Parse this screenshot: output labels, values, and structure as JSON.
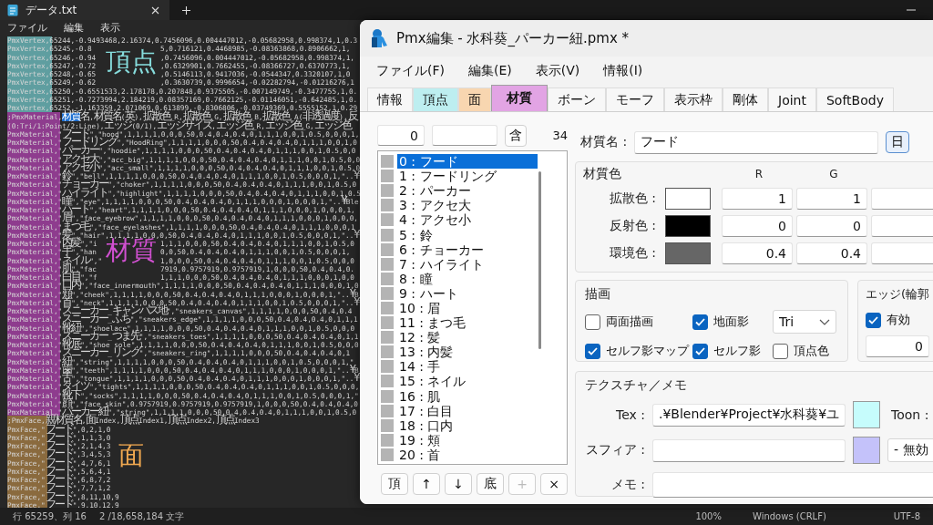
{
  "notepad": {
    "tab_title": "データ.txt",
    "menu": [
      "ファイル",
      "編集",
      "表示"
    ],
    "sections": [
      {
        "kind": "vertex",
        "label": "頂点",
        "color": "#86dcdc",
        "lines": [
          {
            "text": "PmxVertex,65244,-0.9493468,2.16374,0.7456096,0.004447012,-0.05682958,0.998374,1,0.3"
          },
          {
            "text": "PmxVertex,65245,-0.8",
            "after": "5,0.716121,0.4468985,-0.08363868,0.8906662,1,"
          },
          {
            "text": "PmxVertex,65246,-0.94",
            "after": ",0.7456096,0.004447012,-0.05682958,0.998374,1,"
          },
          {
            "text": "PmxVertex,65247,-0.72",
            "after": ",0.6329901,0.7662455,-0.08366727,0.6370773,1,"
          },
          {
            "text": "PmxVertex,65248,-0.65",
            "after": ",0.5146113,0.9417036,-0.0544347,0.3320107,1,0"
          },
          {
            "text": "PmxVertex,65249,-0.62",
            "after": ",0.3630739,0.9996654,-0.02282794,-0.01216276,1"
          },
          {
            "text": "PmxVertex,65250,-0.6551533,2.178178,0.207848,0.9375505,-0.007149749,-0.3477755,1,0."
          },
          {
            "text": "PmxVertex,65251,-0.7273994,2.184219,0.08357169,0.7662125,-0.01146051,-0.642485,1,0."
          },
          {
            "text": "PmxVertex,65252,-1.163359,2.071069,0.613899,-0.8306806,-0.03749369,0.5555152,1,0.29"
          }
        ]
      },
      {
        "kind": "material",
        "label": "材質",
        "color": "#d050d0",
        "lines": [
          {
            "text": ";PmxMaterial,",
            "selection": "材質",
            "tail": "名,材質名(英),拡散色_R,拡散色_G,拡散色_B,拡散色_A(非透過度),反"
          },
          {
            "text": "(0:Tri/1:Point/2:Line),エッジ(0/1),エッジサイズ,エッジ色_R,エッジ色_G,エッジ色"
          },
          {
            "text": "PmxMaterial,\"フード\",\"hood\",1,1,1,1,0,0,0,50,0.4,0.4,0.4,0,1,1,1,0,0,1,0.5,0,0,0,1,"
          },
          {
            "text": "PmxMaterial,\"フードリング\",\"HoodRing\",1,1,1,1,0,0,0,50,0.4,0.4,0.4,0,1,1,1,0,0,1,0"
          },
          {
            "text": "PmxMaterial,\"パーカー\",\"hoodie\",1,1,1,1,0,0,0,50,0.4,0.4,0.4,0,1,1,1,0,0,1,0.5,0,0"
          },
          {
            "text": "PmxMaterial,\"アクセ大\",\"acc_big\",1,1,1,1,0,0,0,50,0.4,0.4,0.4,0,1,1,1,0,0,1,0.5,0,0"
          },
          {
            "text": "PmxMaterial,\"アクセ小\",\"acc_small\",1,1,1,1,0,0,0,50,0.4,0.4,0.4,0,1,1,1,0,0,1,0.5,0"
          },
          {
            "text": "PmxMaterial,\"鈴\",\"bell\",1,1,1,1,0,0,0,50,0.4,0.4,0.4,0,1,1,1,0,0,1,0.5,0,0,0,1,\"..¥"
          },
          {
            "text": "PmxMaterial,\"チョーカー\",\"choker\",1,1,1,1,0,0,0,50,0.4,0.4,0.4,0,1,1,1,0,0,1,0.5,0"
          },
          {
            "text": "PmxMaterial,\"ハイライト\",\"highlight\",1,1,1,1,0,0,0,50,0.4,0.4,0.4,0,1,1,1,0,0,1,0.5"
          },
          {
            "text": "PmxMaterial,\"瞳\",\"eye\",1,1,1,1,0,0,0,50,0.4,0.4,0.4,0,1,1,1,0,0,0,1,0,0,0,1,\"..¥Ble"
          },
          {
            "text": "PmxMaterial,\"ハート\",\"heart\",1,1,1,1,0,0,0,50,0.4,0.4,0.4,0,1,1,1,0,0,0,1,0,0,0,1,"
          },
          {
            "text": "PmxMaterial,\"眉\",\"face_eyebrow\",1,1,1,1,0,0,0,50,0.4,0.4,0.4,0,1,1,1,0,0,0,1,0,0,0,"
          },
          {
            "text": "PmxMaterial,\"まつ毛\",\"face_eyelashes\",1,1,1,1,0,0,0,50,0.4,0.4,0.4,0,1,1,1,0,0,0,1"
          },
          {
            "text": "PmxMaterial,\"髪\",\"hair\",1,1,1,1,0,0,0,50,0.4,0.4,0.4,0,1,1,1,0,0,1,0.5,0,0,0,1,\"..¥"
          },
          {
            "text": "PmxMaterial,\"内髪\",\"i",
            "after": "1,1,1,0,0,0,50,0.4,0.4,0.4,0,1,1,1,0,0,1,0.5,0"
          },
          {
            "text": "PmxMaterial,\"手\",\"han",
            "after": "0,0,50,0.4,0.4,0.4,0,1,1,1,0,0,1,0.5,0,0,0,1,"
          },
          {
            "text": "PmxMaterial,\"ネイル\",\"",
            "after": "1,0,0,0,50,0.4,0.4,0.4,0,1,1,1,0,0,1,0.5,0,0,0"
          },
          {
            "text": "PmxMaterial,\"肌\",\"fac",
            "after": "7919,0.9757919,0.9757919,1,0,0,0,50,0.4,0.4,0."
          },
          {
            "text": "PmxMaterial,\"白目\",\"f",
            "after": "1,1,1,0,0,0,50,0.4,0.4,0.4,0,1,1,1,0,0,0,1,0,0"
          },
          {
            "text": "PmxMaterial,\"口内\",\"face_innermouth\",1,1,1,1,0,0,0,50,0.4,0.4,0.4,0,1,1,1,0,0,0,1,0"
          },
          {
            "text": "PmxMaterial,\"頬\",\"cheek\",1,1,1,1,0,0,0,50,0.4,0.4,0.4,0,1,1,1,0,0,0,1,0,0,0,1,\"..¥B"
          },
          {
            "text": "PmxMaterial,\"首\",\"neck\",1,1,1,1,0,0,0,50,0.4,0.4,0.4,0,1,1,1,0,0,1,0.5,0,0,0,1,\"..¥"
          },
          {
            "text": "PmxMaterial,\"スニーカー_キャンバス地\",\"sneakers_canvas\",1,1,1,1,0,0,0,50,0.4,0.4"
          },
          {
            "text": "PmxMaterial,\"スニーカー_ふち\",\"sneakers_edge\",1,1,1,1,0,0,0,50,0.4,0.4,0.4,0,1,1,1"
          },
          {
            "text": "PmxMaterial,\"靴紐\",\"shoelace\",1,1,1,1,0,0,0,50,0.4,0.4,0.4,0,1,1,1,0,0,1,0.5,0,0,0"
          },
          {
            "text": "PmxMaterial,\"スニーカー_つま先\",\"sneakers_toes\",1,1,1,1,0,0,0,50,0.4,0.4,0.4,0,1,1"
          },
          {
            "text": "PmxMaterial,\"靴底\",\"shoe sole\",1,1,1,1,0,0,0,50,0.4,0.4,0.4,0,1,1,1,0,0,1,0.5,0,0,0"
          },
          {
            "text": "PmxMaterial,\"スニーカー_リング\",\"sneakers_ring\",1,1,1,1,0,0,0,50,0.4,0.4,0.4,0,1"
          },
          {
            "text": "PmxMaterial,\"紐\",\"string\",1,1,1,1,0,0,0,50,0.4,0.4,0.4,0,1,1,1,0,0,1,0.5,0,0,0,1,\""
          },
          {
            "text": "PmxMaterial,\"歯\",\"teeth\",1,1,1,1,0,0,0,50,0.4,0.4,0.4,0,1,1,1,0,0,0,1,0,0,0,1,\"..¥B"
          },
          {
            "text": "PmxMaterial,\"舌\",\"tongue\",1,1,1,1,0,0,0,50,0.4,0.4,0.4,0,1,1,1,0,0,0,1,0,0,0,1,\"..¥"
          },
          {
            "text": "PmxMaterial,\"タイツ\",\"tights\",1,1,1,1,0,0,0,50,0.4,0.4,0.4,0,1,1,1,0,0,1,0.5,0,0,0,"
          },
          {
            "text": "PmxMaterial,\"靴下\",\"socks\",1,1,1,1,0,0,0,50,0.4,0.4,0.4,0,1,1,1,0,0,1,0.5,0,0,0,1,\""
          },
          {
            "text": "PmxMaterial,\"顔\",\"face_skin\",0.9757919,0.9757919,0.9757919,1,0,0,0,50,0.4,0.4,0.4,0"
          },
          {
            "text": "PmxMaterial,\"パーカー紐\",\"string\",1,1,1,1,0,0,0,50,0.4,0.4,0.4,0,1,1,1,0,0,1,0.5,0"
          }
        ]
      },
      {
        "kind": "face",
        "label": "面",
        "color": "#f0a850",
        "lines": [
          {
            "text": ";PmxFace,親材質名,面Index,頂点Index1,頂点Index2,頂点Index3"
          },
          {
            "text": "PmxFace,\"フード\",0,2,1,0"
          },
          {
            "text": "PmxFace,\"フード\",1,1,3,0"
          },
          {
            "text": "PmxFace,\"フード\",2,1,4,3"
          },
          {
            "text": "PmxFace,\"フード\",3,4,5,3"
          },
          {
            "text": "PmxFace,\"フード\",4,7,6,1"
          },
          {
            "text": "PmxFace,\"フード\",5,6,4,1"
          },
          {
            "text": "PmxFace,\"フード\",6,8,7,2"
          },
          {
            "text": "PmxFace,\"フード\",7,7,1,2"
          },
          {
            "text": "PmxFace,\"フード\",8,11,10,9"
          },
          {
            "text": "PmxFace,\"フード\",9,10,12,9"
          }
        ]
      }
    ],
    "status": {
      "position": "行 65259、列 16",
      "count": "2 /18,658,184 文字",
      "zoom": "100%",
      "line_ending": "Windows (CRLF)",
      "encoding": "UTF-8"
    }
  },
  "pmx": {
    "title": "Pmx編集 - 水科葵_パーカー紐.pmx *",
    "menu": [
      "ファイル(F)",
      "編集(E)",
      "表示(V)",
      "情報(I)"
    ],
    "tabs": [
      {
        "label": "情報",
        "selected": false
      },
      {
        "label": "頂点",
        "color": "#bdeef0",
        "selected": false
      },
      {
        "label": "面",
        "color": "#f8d6b0",
        "selected": false
      },
      {
        "label": "材質",
        "color": "#e2a4e4",
        "selected": true
      },
      {
        "label": "ボーン",
        "selected": false
      },
      {
        "label": "モーフ",
        "selected": false
      },
      {
        "label": "表示枠",
        "selected": false
      },
      {
        "label": "剛体",
        "selected": false
      },
      {
        "label": "Joint",
        "selected": false
      },
      {
        "label": "SoftBody",
        "selected": false
      }
    ],
    "list_panel": {
      "index": "0",
      "filter_button": "含",
      "count": "34",
      "items": [
        {
          "label": "0 : フード",
          "selected": true
        },
        {
          "label": "1 : フードリング",
          "selected": false
        },
        {
          "label": "2 : パーカー",
          "selected": false
        },
        {
          "label": "3 : アクセ大",
          "selected": false
        },
        {
          "label": "4 : アクセ小",
          "selected": false
        },
        {
          "label": "5 : 鈴",
          "selected": false
        },
        {
          "label": "6 : チョーカー",
          "selected": false
        },
        {
          "label": "7 : ハイライト",
          "selected": false
        },
        {
          "label": "8 : 瞳",
          "selected": false
        },
        {
          "label": "9 : ハート",
          "selected": false
        },
        {
          "label": "10 : 眉",
          "selected": false
        },
        {
          "label": "11 : まつ毛",
          "selected": false
        },
        {
          "label": "12 : 髪",
          "selected": false
        },
        {
          "label": "13 : 内髪",
          "selected": false
        },
        {
          "label": "14 : 手",
          "selected": false
        },
        {
          "label": "15 : ネイル",
          "selected": false
        },
        {
          "label": "16 : 肌",
          "selected": false
        },
        {
          "label": "17 : 白目",
          "selected": false
        },
        {
          "label": "18 : 口内",
          "selected": false
        },
        {
          "label": "19 : 頬",
          "selected": false
        },
        {
          "label": "20 : 首",
          "selected": false
        }
      ],
      "buttons": [
        {
          "label": "頂",
          "disabled": false
        },
        {
          "label": "↑",
          "disabled": false
        },
        {
          "label": "↓",
          "disabled": false
        },
        {
          "label": "底",
          "disabled": false
        },
        {
          "label": "+",
          "disabled": true
        },
        {
          "label": "×",
          "disabled": false
        }
      ]
    },
    "material": {
      "name_label": "材質名 :",
      "name": "フード",
      "name_button": "日",
      "color_group": {
        "title": "材質色",
        "columns": [
          "R",
          "G"
        ],
        "rows": [
          {
            "label": "拡散色 :",
            "color": "#ffffff",
            "values": [
              "1",
              "1"
            ]
          },
          {
            "label": "反射色 :",
            "color": "#000000",
            "values": [
              "0",
              "0"
            ]
          },
          {
            "label": "環境色 :",
            "color": "#666666",
            "values": [
              "0.4",
              "0.4"
            ]
          }
        ]
      },
      "render_group": {
        "title": "描画",
        "items": [
          {
            "kind": "checkbox",
            "label": "両面描画",
            "checked": false
          },
          {
            "kind": "checkbox",
            "label": "地面影",
            "checked": true
          },
          {
            "kind": "select",
            "value": "Tri"
          },
          {
            "kind": "checkbox",
            "label": "セルフ影マップ",
            "checked": true
          },
          {
            "kind": "checkbox",
            "label": "セルフ影",
            "checked": true
          },
          {
            "kind": "checkbox",
            "label": "頂点色",
            "checked": false
          }
        ]
      },
      "edge_group": {
        "title": "エッジ(輪郭",
        "enabled_label": "有効",
        "enabled": true,
        "size": "0"
      },
      "texture_group": {
        "title": "テクスチャ／メモ",
        "rows": [
          {
            "kind": "texture",
            "label": "Tex :",
            "value": ".¥Blender¥Project¥水科葵¥ユ",
            "color": "#c6fcfc",
            "side_label": "Toon :"
          },
          {
            "kind": "sphere",
            "label": "スフィア :",
            "color": "#c4c2fa",
            "select": "- 無効"
          },
          {
            "kind": "memo",
            "label": "メモ :"
          }
        ]
      }
    }
  }
}
